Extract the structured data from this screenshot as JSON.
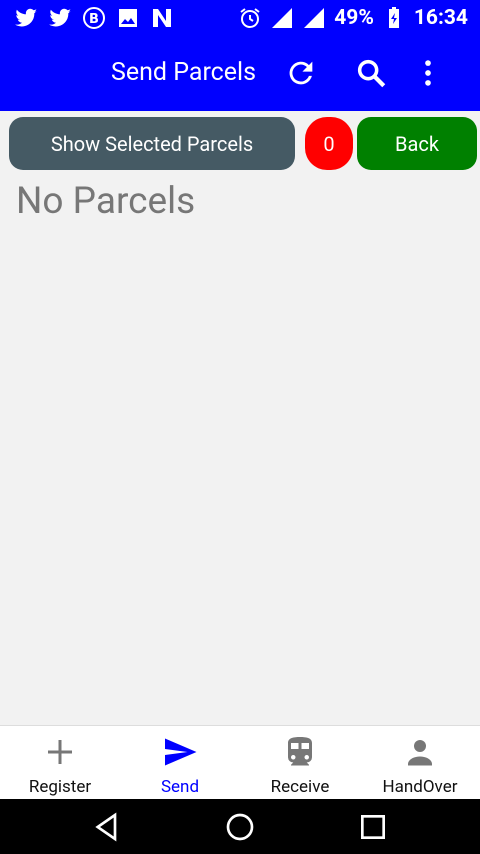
{
  "status_bar": {
    "notification_icons": [
      "twitter-icon",
      "twitter-icon",
      "bitcoin-icon",
      "image-icon",
      "n-app-icon"
    ],
    "battery_percent": "49%",
    "time": "16:34"
  },
  "app_bar": {
    "title": "Send Parcels",
    "actions": [
      "refresh-icon",
      "search-icon",
      "more-vert-icon"
    ]
  },
  "actions": {
    "show_selected_label": "Show Selected Parcels",
    "selected_count": "0",
    "back_label": "Back"
  },
  "content": {
    "empty_message": "No Parcels"
  },
  "bottom_nav": {
    "items": [
      {
        "label": "Register",
        "icon": "plus-icon",
        "active": false
      },
      {
        "label": "Send",
        "icon": "send-icon",
        "active": true
      },
      {
        "label": "Receive",
        "icon": "train-icon",
        "active": false
      },
      {
        "label": "HandOver",
        "icon": "person-icon",
        "active": false
      }
    ]
  },
  "colors": {
    "primary": "#0000ff",
    "show_button": "#455a64",
    "count_badge": "#ff0000",
    "back_button": "#008000"
  }
}
